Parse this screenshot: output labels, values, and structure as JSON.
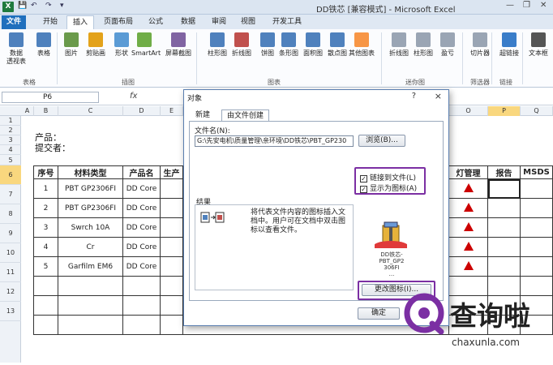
{
  "window": {
    "title": "DD铁芯  [兼容模式]  -  Microsoft Excel",
    "app_icon_letter": "X"
  },
  "tabs": [
    {
      "label": "文件",
      "type": "file"
    },
    {
      "label": "开始"
    },
    {
      "label": "插入",
      "active": true
    },
    {
      "label": "页面布局"
    },
    {
      "label": "公式"
    },
    {
      "label": "数据"
    },
    {
      "label": "审阅"
    },
    {
      "label": "视图"
    },
    {
      "label": "开发工具"
    }
  ],
  "ribbon": {
    "buttons": [
      {
        "label": "数据\n透视表",
        "icon": "pivot-table-icon",
        "color": "#4f81bd"
      },
      {
        "label": "表格",
        "icon": "table-icon",
        "color": "#4f81bd"
      },
      {
        "label": "图片",
        "icon": "picture-icon",
        "color": "#6a9a4b"
      },
      {
        "label": "剪贴画",
        "icon": "clipart-icon",
        "color": "#e3a21a"
      },
      {
        "label": "形状",
        "icon": "shapes-icon",
        "color": "#5b9bd5"
      },
      {
        "label": "SmartArt",
        "icon": "smartart-icon",
        "color": "#70ad47"
      },
      {
        "label": "屏幕截图",
        "icon": "screenshot-icon",
        "color": "#8064a2"
      },
      {
        "label": "柱形图",
        "icon": "column-chart-icon",
        "color": "#4f81bd"
      },
      {
        "label": "折线图",
        "icon": "line-chart-icon",
        "color": "#c0504d"
      },
      {
        "label": "饼图",
        "icon": "pie-chart-icon",
        "color": "#4f81bd"
      },
      {
        "label": "条形图",
        "icon": "bar-chart-icon",
        "color": "#4f81bd"
      },
      {
        "label": "面积图",
        "icon": "area-chart-icon",
        "color": "#4f81bd"
      },
      {
        "label": "散点图",
        "icon": "scatter-chart-icon",
        "color": "#4f81bd"
      },
      {
        "label": "其他图表",
        "icon": "other-charts-icon",
        "color": "#f79646"
      },
      {
        "label": "折线图",
        "icon": "sparkline-line-icon",
        "color": "#9aa5b4"
      },
      {
        "label": "柱形图",
        "icon": "sparkline-column-icon",
        "color": "#9aa5b4"
      },
      {
        "label": "盈亏",
        "icon": "sparkline-winloss-icon",
        "color": "#9aa5b4"
      },
      {
        "label": "切片器",
        "icon": "slicer-icon",
        "color": "#9aa5b4"
      },
      {
        "label": "超链接",
        "icon": "hyperlink-icon",
        "color": "#3a7dc9"
      },
      {
        "label": "文本框",
        "icon": "textbox-icon",
        "color": "#555"
      }
    ],
    "groups": [
      "表格",
      "插图",
      "图表",
      "迷你图",
      "筛选器",
      "链接"
    ]
  },
  "formula_bar": {
    "name_box": "P6",
    "fx": "fx"
  },
  "columns": [
    "A",
    "B",
    "C",
    "D",
    "E",
    "O",
    "P",
    "Q"
  ],
  "rows": [
    "1",
    "2",
    "3",
    "4",
    "5",
    "6",
    "7",
    "8",
    "9",
    "10",
    "11",
    "12",
    "13"
  ],
  "sheet": {
    "product_label": "产品：",
    "submitter_label": "提交者：",
    "headers": [
      "序号",
      "材料类型",
      "产品名",
      "生产",
      "灯管理",
      "报告",
      "MSDS"
    ],
    "rows": [
      {
        "no": "1",
        "material": "PBT GP2306FI",
        "product": "DD Core"
      },
      {
        "no": "2",
        "material": "PBT GP2306FI",
        "product": "DD Core"
      },
      {
        "no": "3",
        "material": "Swrch 10A",
        "product": "DD Core"
      },
      {
        "no": "4",
        "material": "Cr",
        "product": "DD Core"
      },
      {
        "no": "5",
        "material": "Garfilm EM6",
        "product": "DD Core"
      }
    ]
  },
  "dialog": {
    "title": "对象",
    "help": "?",
    "close": "×",
    "tabs": [
      "新建",
      "由文件创建"
    ],
    "filename_label": "文件名(N):",
    "filename_value": "G:\\先安电机\\质量管理\\亲环境\\DD铁芯\\PBT_GP230",
    "browse": "浏览(B)...",
    "link_to_file": "链接到文件(L)",
    "display_as_icon": "显示为图标(A)",
    "result_label": "结果",
    "result_text": "将代表文件内容的图标插入文档中。用户可在文档中双击图标以查看文件。",
    "icon_caption_lines": [
      "DD铁芯-",
      "PBT_GP2",
      "306FI",
      "..."
    ],
    "change_icon": "更改图标(I)...",
    "ok": "确定"
  },
  "watermark": {
    "brand": "查询啦",
    "url": "chaxunla.com",
    "color": "#7b2fa3"
  }
}
